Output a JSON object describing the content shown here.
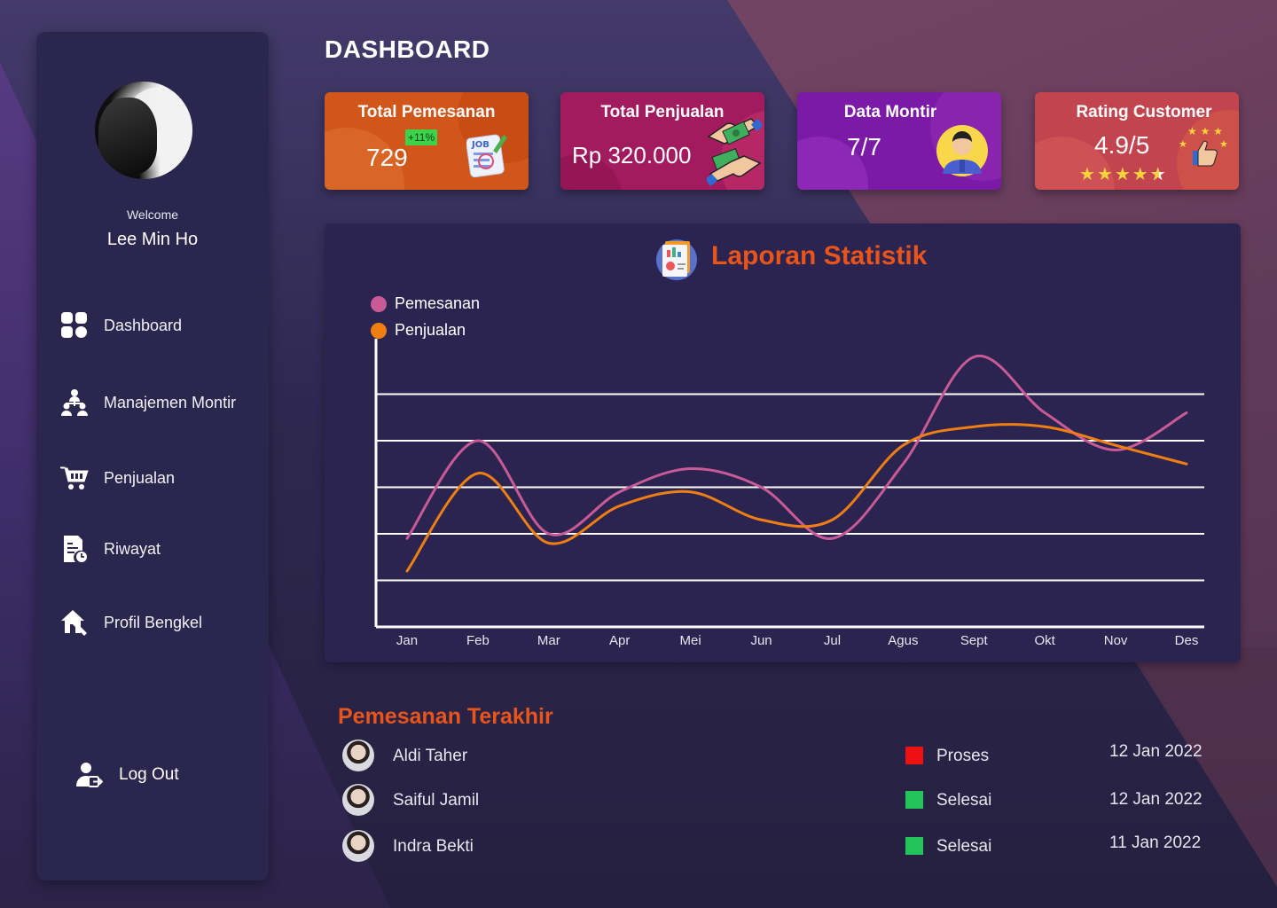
{
  "sidebar": {
    "welcome": "Welcome",
    "username": "Lee Min Ho",
    "items": [
      {
        "label": "Dashboard",
        "icon": "dashboard-grid-icon"
      },
      {
        "label": "Manajemen Montir",
        "icon": "team-hierarchy-icon"
      },
      {
        "label": "Penjualan",
        "icon": "shopping-cart-icon"
      },
      {
        "label": "Riwayat",
        "icon": "document-history-icon"
      },
      {
        "label": "Profil Bengkel",
        "icon": "house-wrench-icon"
      }
    ],
    "logout": {
      "label": "Log Out",
      "icon": "user-logout-icon"
    }
  },
  "page_title": "DASHBOARD",
  "cards": [
    {
      "title": "Total Pemesanan",
      "value": "729",
      "badge": "+11%",
      "icon": "job-document-icon",
      "color": "#d0561a"
    },
    {
      "title": "Total Penjualan",
      "value": "Rp 320.000",
      "icon": "money-exchange-icon",
      "color": "#a21b5e"
    },
    {
      "title": "Data Montir",
      "value": "7/7",
      "icon": "mechanic-avatar-icon",
      "color": "#7a1aa6"
    },
    {
      "title": "Rating Customer",
      "value": "4.9/5",
      "rating": 4.5,
      "icon": "thumbs-up-stars-icon",
      "color": "#c2444e"
    }
  ],
  "chart": {
    "title": "Laporan Statistik",
    "legend": [
      {
        "name": "Pemesanan",
        "color": "#c85a96"
      },
      {
        "name": "Penjualan",
        "color": "#f07f12"
      }
    ]
  },
  "chart_data": {
    "type": "line",
    "x": [
      "Jan",
      "Feb",
      "Mar",
      "Apr",
      "Mei",
      "Jun",
      "Jul",
      "Agus",
      "Sept",
      "Okt",
      "Nov",
      "Des"
    ],
    "xlabel": "",
    "ylabel": "",
    "ylim": [
      0,
      6
    ],
    "grid": true,
    "legend_position": "top-left",
    "series": [
      {
        "name": "Pemesanan",
        "color": "#c85a96",
        "values": [
          1.9,
          4.0,
          2.0,
          2.9,
          3.4,
          3.0,
          1.9,
          3.5,
          5.8,
          4.6,
          3.8,
          4.6
        ]
      },
      {
        "name": "Penjualan",
        "color": "#f07f12",
        "values": [
          1.2,
          3.3,
          1.8,
          2.6,
          2.9,
          2.3,
          2.3,
          3.9,
          4.3,
          4.3,
          3.9,
          3.5
        ]
      }
    ]
  },
  "recent": {
    "title": "Pemesanan Terakhir",
    "rows": [
      {
        "name": "Aldi Taher",
        "status": "Proses",
        "status_color": "#ee1111",
        "date": "12 Jan 2022"
      },
      {
        "name": "Saiful Jamil",
        "status": "Selesai",
        "status_color": "#22c45a",
        "date": "12 Jan 2022"
      },
      {
        "name": "Indra Bekti",
        "status": "Selesai",
        "status_color": "#22c45a",
        "date": "11 Jan 2022"
      }
    ]
  }
}
